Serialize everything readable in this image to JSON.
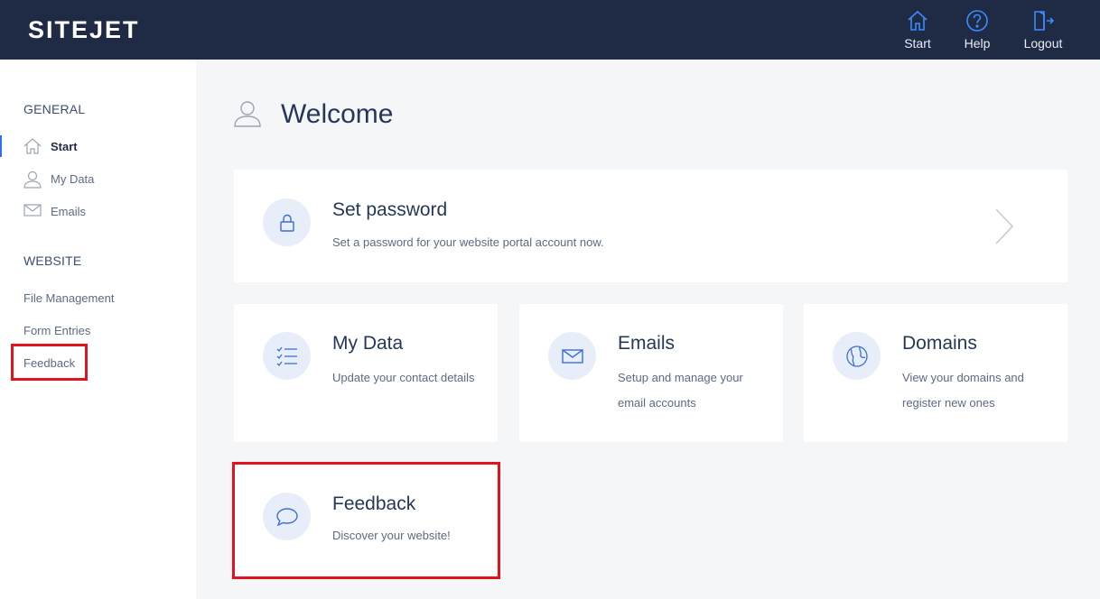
{
  "header": {
    "logo": "SITEJET",
    "nav": [
      {
        "label": "Start",
        "icon": "home-icon"
      },
      {
        "label": "Help",
        "icon": "help-icon"
      },
      {
        "label": "Logout",
        "icon": "logout-icon"
      }
    ]
  },
  "sidebar": {
    "general_heading": "GENERAL",
    "general_items": [
      {
        "label": "Start",
        "icon": "home-icon",
        "active": true
      },
      {
        "label": "My Data",
        "icon": "user-icon"
      },
      {
        "label": "Emails",
        "icon": "mail-icon"
      }
    ],
    "website_heading": "WEBSITE",
    "website_items": [
      {
        "label": "File Management"
      },
      {
        "label": "Form Entries"
      },
      {
        "label": "Feedback",
        "highlighted": true
      }
    ]
  },
  "main": {
    "title": "Welcome",
    "cards": {
      "password": {
        "title": "Set password",
        "desc": "Set a password for your website portal account now.",
        "icon": "lock-icon"
      },
      "mydata": {
        "title": "My Data",
        "desc": "Update your contact details",
        "icon": "checklist-icon"
      },
      "emails": {
        "title": "Emails",
        "desc": "Setup and manage your email accounts",
        "icon": "mail-icon"
      },
      "domains": {
        "title": "Domains",
        "desc": "View your domains and register new ones",
        "icon": "globe-icon"
      },
      "feedback": {
        "title": "Feedback",
        "desc": "Discover your website!",
        "icon": "speech-bubble-icon",
        "highlighted": true
      }
    }
  },
  "colors": {
    "header_bg": "#1f2b45",
    "accent": "#2d6ff7",
    "highlight_box": "#e0141c",
    "icon_circle": "#e8eef9"
  }
}
